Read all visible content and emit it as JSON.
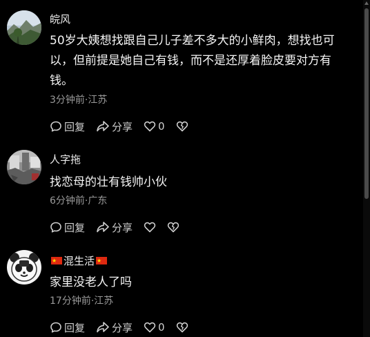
{
  "comments": [
    {
      "username": "皖风",
      "content": "50岁大姨想找跟自己儿子差不多大的小鲜肉，想找也可以，但前提是她自己有钱，而不是还厚着脸皮要对方有钱。",
      "meta": "3分钟前·江苏",
      "reply_label": "回复",
      "share_label": "分享",
      "like_count": "0",
      "avatar_icon": "landscape-avatar-icon"
    },
    {
      "username": "人字拖",
      "content": "找恋母的壮有钱帅小伙",
      "meta": "6分钟前·广东",
      "reply_label": "回复",
      "share_label": "分享",
      "like_count": "",
      "avatar_icon": "ruins-avatar-icon"
    },
    {
      "username": "混生活",
      "content": "家里没老人了吗",
      "meta": "17分钟前·江苏",
      "reply_label": "回复",
      "share_label": "分享",
      "like_count": "0",
      "avatar_icon": "panda-meme-avatar-icon"
    }
  ],
  "colors": {
    "background": "#000000",
    "text_primary": "#f5f5f5",
    "text_secondary": "#9a9a9a",
    "action_text": "#cfcfcf",
    "flag_red": "#de2910"
  }
}
